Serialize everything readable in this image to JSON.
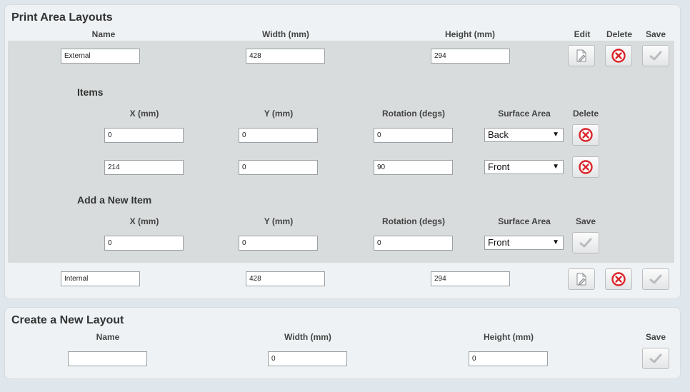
{
  "layouts_panel": {
    "title": "Print Area Layouts",
    "headers": {
      "name": "Name",
      "width": "Width (mm)",
      "height": "Height (mm)",
      "edit": "Edit",
      "delete": "Delete",
      "save": "Save"
    },
    "layouts": [
      {
        "name": "External",
        "width": "428",
        "height": "294"
      },
      {
        "name": "Internal",
        "width": "428",
        "height": "294"
      }
    ],
    "items_section": {
      "title": "Items",
      "headers": {
        "x": "X (mm)",
        "y": "Y (mm)",
        "rotation": "Rotation (degs)",
        "surface": "Surface Area",
        "delete": "Delete"
      },
      "items": [
        {
          "x": "0",
          "y": "0",
          "rotation": "0",
          "surface": "Back"
        },
        {
          "x": "214",
          "y": "0",
          "rotation": "90",
          "surface": "Front"
        }
      ]
    },
    "new_item_section": {
      "title": "Add a New Item",
      "headers": {
        "x": "X (mm)",
        "y": "Y (mm)",
        "rotation": "Rotation (degs)",
        "surface": "Surface Area",
        "save": "Save"
      },
      "values": {
        "x": "0",
        "y": "0",
        "rotation": "0",
        "surface": "Front"
      }
    }
  },
  "create_panel": {
    "title": "Create a New Layout",
    "headers": {
      "name": "Name",
      "width": "Width (mm)",
      "height": "Height (mm)",
      "save": "Save"
    },
    "values": {
      "name": "",
      "width": "0",
      "height": "0"
    }
  },
  "icons": {
    "edit": "edit-icon",
    "delete": "delete-icon",
    "save": "check-icon"
  },
  "colors": {
    "delete_red": "#d9252a",
    "check_gray": "#b8bcbf"
  }
}
